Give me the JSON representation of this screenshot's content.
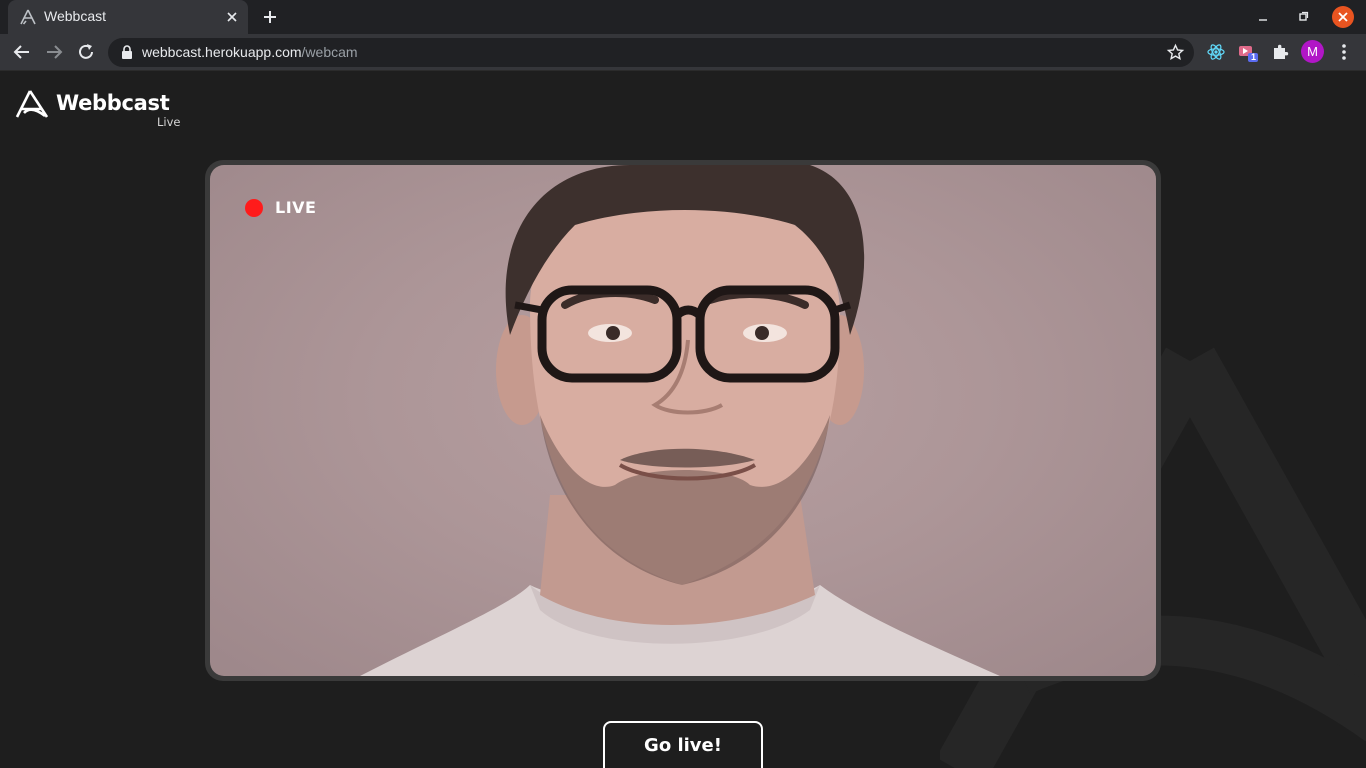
{
  "browser": {
    "tab_title": "Webbcast",
    "url_host": "webbcast.herokuapp.com",
    "url_path": "/webcam",
    "profile_initial": "M",
    "extension_badge": "1",
    "icons": [
      "webbcast-favicon",
      "close-icon",
      "plus-icon",
      "minimize-icon",
      "restore-icon",
      "window-close-icon",
      "back-arrow-icon",
      "forward-arrow-icon",
      "reload-icon",
      "lock-icon",
      "star-icon",
      "react-devtools-icon",
      "extension-icon",
      "puzzle-icon",
      "more-vert-icon"
    ]
  },
  "app": {
    "brand_name": "Webbcast",
    "brand_sub": "Live",
    "live_label": "LIVE",
    "live_color": "#ff1b1b",
    "go_live_label": "Go live!"
  }
}
